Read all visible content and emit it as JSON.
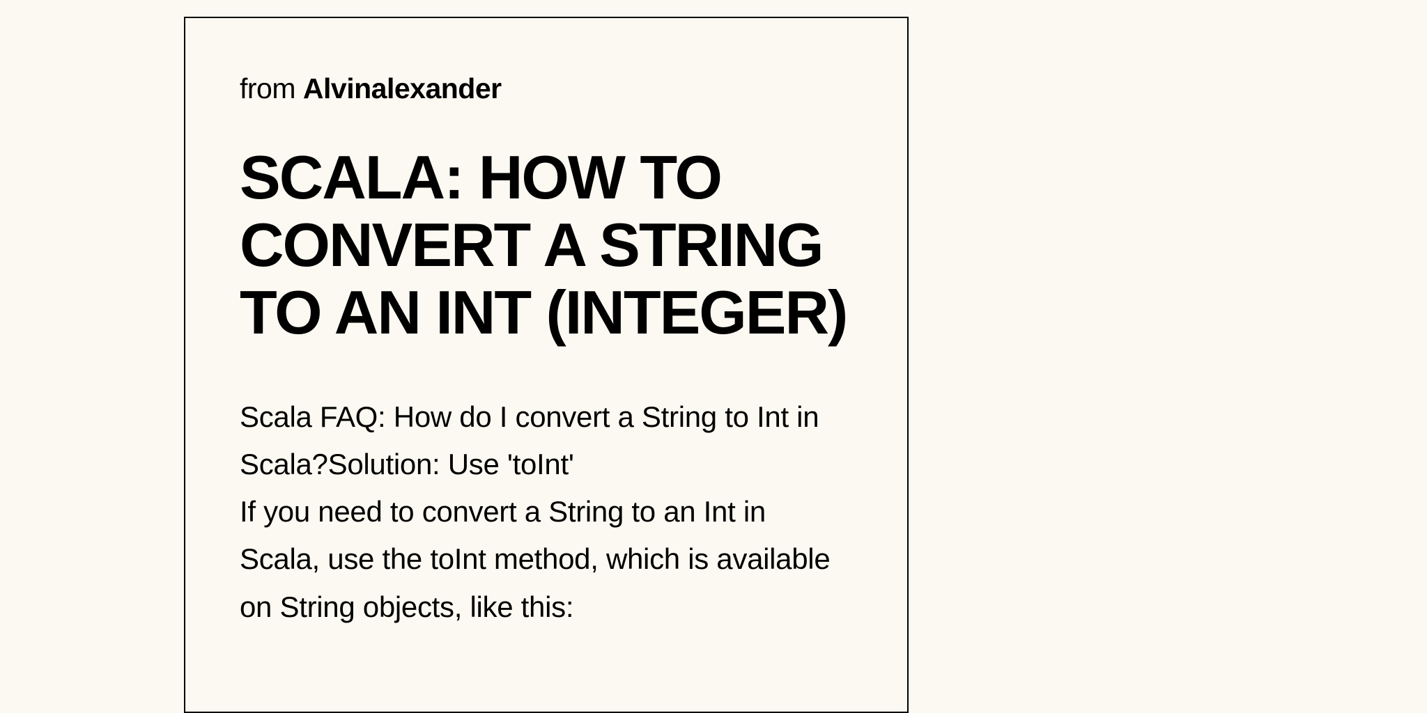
{
  "source": {
    "prefix": "from ",
    "author": "Alvinalexander"
  },
  "title": "SCALA: HOW TO CONVERT A STRING TO AN INT (INTEGER)",
  "body": {
    "paragraph1": "Scala FAQ: How do I convert a String to Int in Scala?Solution: Use 'toInt'",
    "paragraph2": "If you need to convert a String to an Int in Scala, use the toInt method, which is available on String objects, like this:"
  }
}
